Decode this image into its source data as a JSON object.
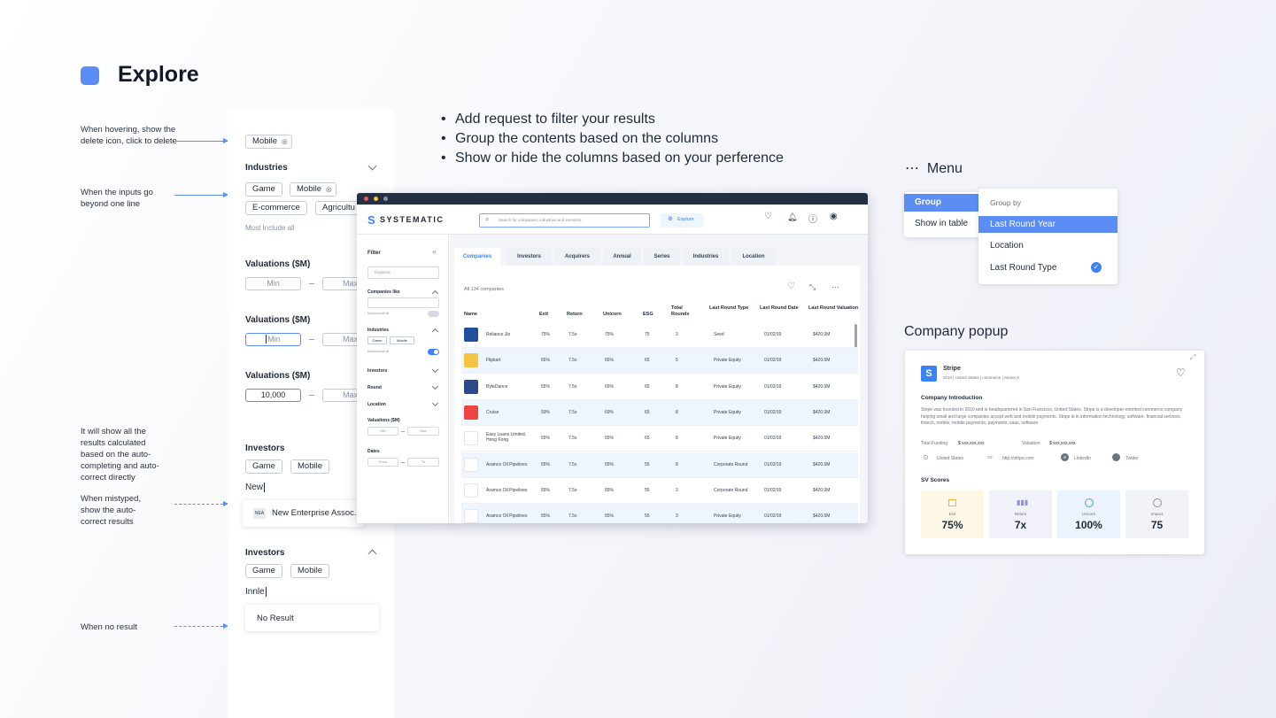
{
  "title": "Explore",
  "notes": {
    "hover": "When hovering, show the delete icon, click to delete",
    "inputs": "When the inputs go beyond one line",
    "autocomplete": "It will show all the results calculated based on the auto-completing and auto-correct directly",
    "mistyped": "When mistyped, show the auto-correct results",
    "noresult": "When no result"
  },
  "panel": {
    "chip_mobile": "Mobile",
    "industries": "Industries",
    "ind_chips": [
      "Game",
      "Mobile",
      "E-commerce",
      "Agricultu"
    ],
    "must_include": "Must Include all",
    "val1": "Valuations ($M)",
    "val1_min": "Min",
    "val1_max": "Max",
    "val2": "Valuations ($M)",
    "val2_min": "Min",
    "val2_max": "Max",
    "val3": "Valuations ($M)",
    "val3_min": "10,000",
    "val3_max": "Max",
    "inv1": "Investors",
    "inv1_chips": [
      "Game",
      "Mobile"
    ],
    "inv1_typed": "New",
    "suggest_logo": "NEA",
    "suggest_text": "New Enterprise Assoc...",
    "inv2": "Investors",
    "inv2_chips": [
      "Game",
      "Mobile"
    ],
    "inv2_typed": "Innle",
    "no_result": "No Result"
  },
  "bullets": [
    "Add request to filter your results",
    "Group the contents based on the columns",
    "Show or hide the columns based on your perference"
  ],
  "app": {
    "brand": "SYSTEMATIC",
    "search_placeholder": "Search for companies, industries and investors",
    "explore": "Explore",
    "filter": "Filter",
    "keyword": "Keyword",
    "side": [
      "Companies like",
      "Must include all",
      "Industries",
      "Game",
      "Mobile",
      "Must include all",
      "Investors",
      "Round",
      "Location",
      "Valuations ($M)",
      "Min",
      "Max",
      "Dates",
      "From",
      "To"
    ],
    "tabs": [
      "Companies",
      "Investors",
      "Acquirers",
      "Annual",
      "Series",
      "Industries",
      "Location"
    ],
    "count": "All 134 companies",
    "headers": [
      "Name",
      "Exit",
      "Return",
      "Unicorn",
      "ESG",
      "Total Rounds",
      "Last Round Type",
      "Last Round Date",
      "Last Round Valuation"
    ],
    "rows": [
      [
        "Reliance Jio",
        "75%",
        "7.5x",
        "75%",
        "75",
        "3",
        "Seed",
        "01/02/19",
        "$420.0M"
      ],
      [
        "Flipkart",
        "65%",
        "7.5x",
        "65%",
        "65",
        "5",
        "Private Equity",
        "01/02/19",
        "$420.0M"
      ],
      [
        "ByteDance",
        "55%",
        "7.5x",
        "65%",
        "65",
        "8",
        "Private Equity",
        "01/02/19",
        "$420.0M"
      ],
      [
        "Cruise",
        "59%",
        "7.5x",
        "69%",
        "65",
        "8",
        "Private Equity",
        "01/02/19",
        "$420.0M"
      ],
      [
        "Easy Loans Limited, Hong Kong",
        "55%",
        "7.5x",
        "55%",
        "65",
        "8",
        "Private Equity",
        "01/02/19",
        "$420.0M"
      ],
      [
        "Aramco Oil Pipelines",
        "55%",
        "7.5x",
        "55%",
        "55",
        "8",
        "Corporate Round",
        "01/02/19",
        "$420.0M"
      ],
      [
        "Aramco Oil Pipelines",
        "55%",
        "7.5x",
        "55%",
        "55",
        "3",
        "Corporate Round",
        "01/02/19",
        "$420.0M"
      ],
      [
        "Aramco Oil Pipelines",
        "55%",
        "7.5x",
        "55%",
        "55",
        "3",
        "Private Equity",
        "01/02/19",
        "$420.0M"
      ]
    ]
  },
  "menu": {
    "label": "Menu",
    "left": [
      "Group",
      "Show in table"
    ],
    "group_by": "Group by",
    "options": [
      "Last Round Year",
      "Location",
      "Last Round Type"
    ]
  },
  "popup": {
    "label": "Company popup",
    "name": "Stripe",
    "meta": "2010 | United States | commerce | Series X",
    "intro_title": "Company Introduction",
    "intro": "Stripe was founded in 2010 and is headquartered in San Francisco, United States. Stripe is a developer-oriented commerce company helping small and large companies accept web and mobile payments. Stripe is in information technology, software, financial services, fintech, mobile, mobile payments, payments, saas, software",
    "funding_label": "Total Funding",
    "funding": "$ xxx,xxx,xxx",
    "valuation_label": "Valuation",
    "valuation": "$ xxx,xxx,xxx",
    "links": [
      "United States",
      "http://stripe.com",
      "LinkedIn",
      "Twitter"
    ],
    "scores_title": "SV Scores",
    "scores": [
      {
        "name": "Exit",
        "value": "75%"
      },
      {
        "name": "Return",
        "value": "7x"
      },
      {
        "name": "Unicorn",
        "value": "100%"
      },
      {
        "name": "Impact",
        "value": "75"
      }
    ]
  },
  "colors": {
    "accent": "#5b8df5",
    "blue": "#3b82f6",
    "dark": "#233044"
  }
}
